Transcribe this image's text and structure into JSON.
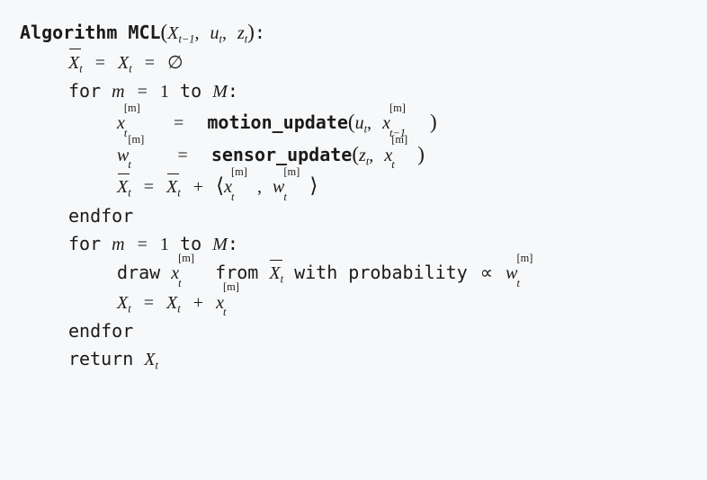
{
  "algorithm": {
    "kw_algorithm": "Algorithm",
    "name": "MCL",
    "param_X": "X",
    "param_X_sub": "t−1",
    "param_u": "u",
    "param_u_sub": "t",
    "param_z": "z",
    "param_z_sub": "t",
    "colon": ":",
    "comma": ",",
    "lparen": "(",
    "rparen": ")"
  },
  "line_init": {
    "Xbar": "X",
    "Xbar_sub": "t",
    "eq": "=",
    "X": "X",
    "X_sub": "t",
    "empty": "∅"
  },
  "for1": {
    "kw_for": "for",
    "m": "m",
    "eq": "=",
    "one": "1",
    "kw_to": "to",
    "M": "M",
    "colon": ":"
  },
  "motion": {
    "x": "x",
    "x_sub": "t",
    "x_sup": "[m]",
    "eq": "=",
    "fn": "motion_update",
    "lparen": "(",
    "u": "u",
    "u_sub": "t",
    "comma": ",",
    "x2": "x",
    "x2_sub": "t−1",
    "x2_sup": "[m]",
    "rparen": ")"
  },
  "sensor": {
    "w": "w",
    "w_sub": "t",
    "w_sup": "[m]",
    "eq": "=",
    "fn": "sensor_update",
    "lparen": "(",
    "z": "z",
    "z_sub": "t",
    "comma": ",",
    "x": "x",
    "x_sub": "t",
    "x_sup": "[m]",
    "rparen": ")"
  },
  "accum": {
    "Xbar": "X",
    "Xbar_sub": "t",
    "eq": "=",
    "Xbar2": "X",
    "Xbar2_sub": "t",
    "plus": "+",
    "langle": "⟨",
    "x": "x",
    "x_sub": "t",
    "x_sup": "[m]",
    "comma": ",",
    "w": "w",
    "w_sub": "t",
    "w_sup": "[m]",
    "rangle": "⟩"
  },
  "endfor1": {
    "kw": "endfor"
  },
  "for2": {
    "kw_for": "for",
    "m": "m",
    "eq": "=",
    "one": "1",
    "kw_to": "to",
    "M": "M",
    "colon": ":"
  },
  "draw": {
    "kw_draw": "draw",
    "x": "x",
    "x_sub": "t",
    "x_sup": "[m]",
    "kw_from": "from",
    "Xbar": "X",
    "Xbar_sub": "t",
    "kw_with_prob": "with probability",
    "prop": "∝",
    "w": "w",
    "w_sub": "t",
    "w_sup": "[m]"
  },
  "accum2": {
    "X": "X",
    "X_sub": "t",
    "eq": "=",
    "X2": "X",
    "X2_sub": "t",
    "plus": "+",
    "x": "x",
    "x_sub": "t",
    "x_sup": "[m]"
  },
  "endfor2": {
    "kw": "endfor"
  },
  "return": {
    "kw": "return",
    "X": "X",
    "X_sub": "t"
  }
}
